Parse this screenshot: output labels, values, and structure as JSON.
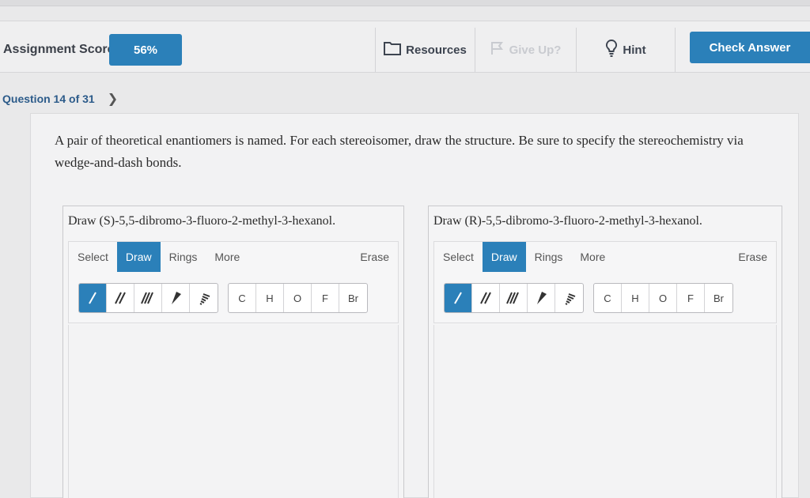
{
  "header": {
    "score_label": "Assignment Score:",
    "score_value": "56%",
    "resources_label": "Resources",
    "giveup_label": "Give Up?",
    "hint_label": "Hint",
    "check_label": "Check Answer"
  },
  "question_nav": {
    "label": "Question 14 of 31"
  },
  "prompt": "A pair of theoretical enantiomers is named. For each stereoisomer, draw the structure. Be sure to specify the stereochemistry via wedge-and-dash bonds.",
  "panels": [
    {
      "title": "Draw (S)-5,5-dibromo-3-fluoro-2-methyl-3-hexanol.",
      "tabs": [
        "Select",
        "Draw",
        "Rings",
        "More",
        "Erase"
      ],
      "atoms": [
        "C",
        "H",
        "O",
        "F",
        "Br"
      ]
    },
    {
      "title": "Draw (R)-5,5-dibromo-3-fluoro-2-methyl-3-hexanol.",
      "tabs": [
        "Select",
        "Draw",
        "Rings",
        "More",
        "Erase"
      ],
      "atoms": [
        "C",
        "H",
        "O",
        "F",
        "Br"
      ]
    }
  ],
  "colors": {
    "accent": "#2b80b9",
    "nav_link": "#2c5b8a"
  }
}
